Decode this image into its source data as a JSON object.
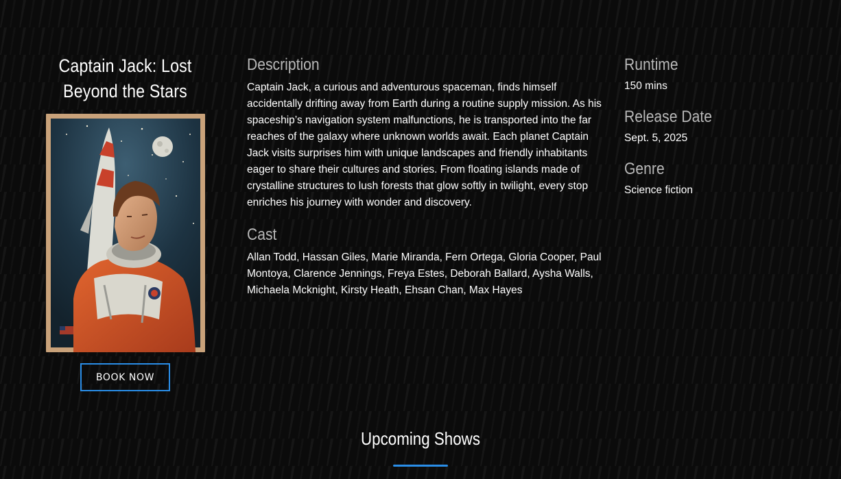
{
  "movie": {
    "title": "Captain Jack: Lost Beyond the Stars",
    "book_label": "BOOK NOW"
  },
  "description": {
    "heading": "Description",
    "text": "Captain Jack, a curious and adventurous spaceman, finds himself accidentally drifting away from Earth during a routine supply mission. As his spaceship’s navigation system malfunctions, he is transported into the far reaches of the galaxy where unknown worlds await. Each planet Captain Jack visits surprises him with unique landscapes and friendly inhabitants eager to share their cultures and stories. From floating islands made of crystalline structures to lush forests that glow softly in twilight, every stop enriches his journey with wonder and discovery."
  },
  "cast": {
    "heading": "Cast",
    "text": "Allan Todd, Hassan Giles, Marie Miranda, Fern Ortega, Gloria Cooper, Paul Montoya, Clarence Jennings, Freya Estes, Deborah Ballard, Aysha Walls, Michaela Mcknight, Kirsty Heath, Ehsan Chan, Max Hayes"
  },
  "details": {
    "runtime_heading": "Runtime",
    "runtime_value": "150 mins",
    "release_heading": "Release Date",
    "release_value": "Sept. 5, 2025",
    "genre_heading": "Genre",
    "genre_value": "Science fiction"
  },
  "upcoming": {
    "title": "Upcoming Shows"
  },
  "colors": {
    "accent": "#2a8ee8",
    "background": "#0b0b0b",
    "heading_gray": "#b8b8b8"
  }
}
